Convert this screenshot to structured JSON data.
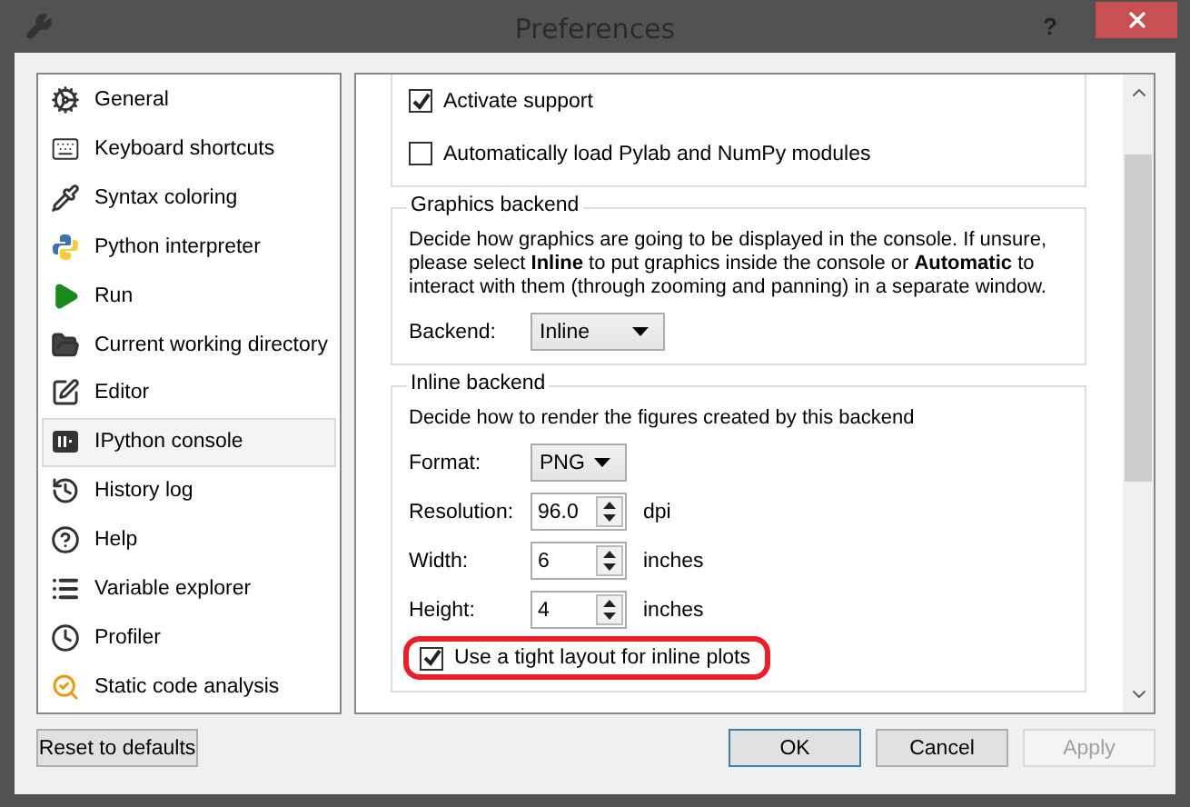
{
  "window": {
    "title": "Preferences",
    "help": "?"
  },
  "sidebar": {
    "items": [
      {
        "label": "General",
        "selected": false
      },
      {
        "label": "Keyboard shortcuts",
        "selected": false
      },
      {
        "label": "Syntax coloring",
        "selected": false
      },
      {
        "label": "Python interpreter",
        "selected": false
      },
      {
        "label": "Run",
        "selected": false
      },
      {
        "label": "Current working directory",
        "selected": false
      },
      {
        "label": "Editor",
        "selected": false
      },
      {
        "label": "IPython console",
        "selected": true
      },
      {
        "label": "History log",
        "selected": false
      },
      {
        "label": "Help",
        "selected": false
      },
      {
        "label": "Variable explorer",
        "selected": false
      },
      {
        "label": "Profiler",
        "selected": false
      },
      {
        "label": "Static code analysis",
        "selected": false
      }
    ]
  },
  "support_group": {
    "checkboxes": [
      {
        "label": "Activate support",
        "checked": true
      },
      {
        "label": "Automatically load Pylab and NumPy modules",
        "checked": false
      }
    ]
  },
  "graphics_backend": {
    "title": "Graphics backend",
    "description": "Decide how graphics are going to be displayed in the console. If unsure, please select **Inline** to put graphics inside the console or **Automatic** to interact with them (through zooming and panning) in a separate window.",
    "backend": {
      "label": "Backend:",
      "value": "Inline"
    }
  },
  "inline_backend": {
    "title": "Inline backend",
    "description": "Decide how to render the figures created by this backend",
    "fields": [
      {
        "kind": "combo",
        "label": "Format:",
        "value": "PNG"
      },
      {
        "kind": "spin",
        "label": "Resolution:",
        "value": "96.0",
        "unit": "dpi"
      },
      {
        "kind": "spin",
        "label": "Width:",
        "value": "6",
        "unit": "inches"
      },
      {
        "kind": "spin",
        "label": "Height:",
        "value": "4",
        "unit": "inches"
      }
    ],
    "tight_layout": {
      "label": "Use a tight layout for inline plots",
      "checked": true,
      "highlighted": true
    }
  },
  "buttons": {
    "reset": {
      "label": "Reset to defaults"
    },
    "actions": [
      {
        "label": "OK",
        "default": true,
        "disabled": false
      },
      {
        "label": "Cancel",
        "default": false,
        "disabled": false
      },
      {
        "label": "Apply",
        "default": false,
        "disabled": true
      }
    ]
  }
}
